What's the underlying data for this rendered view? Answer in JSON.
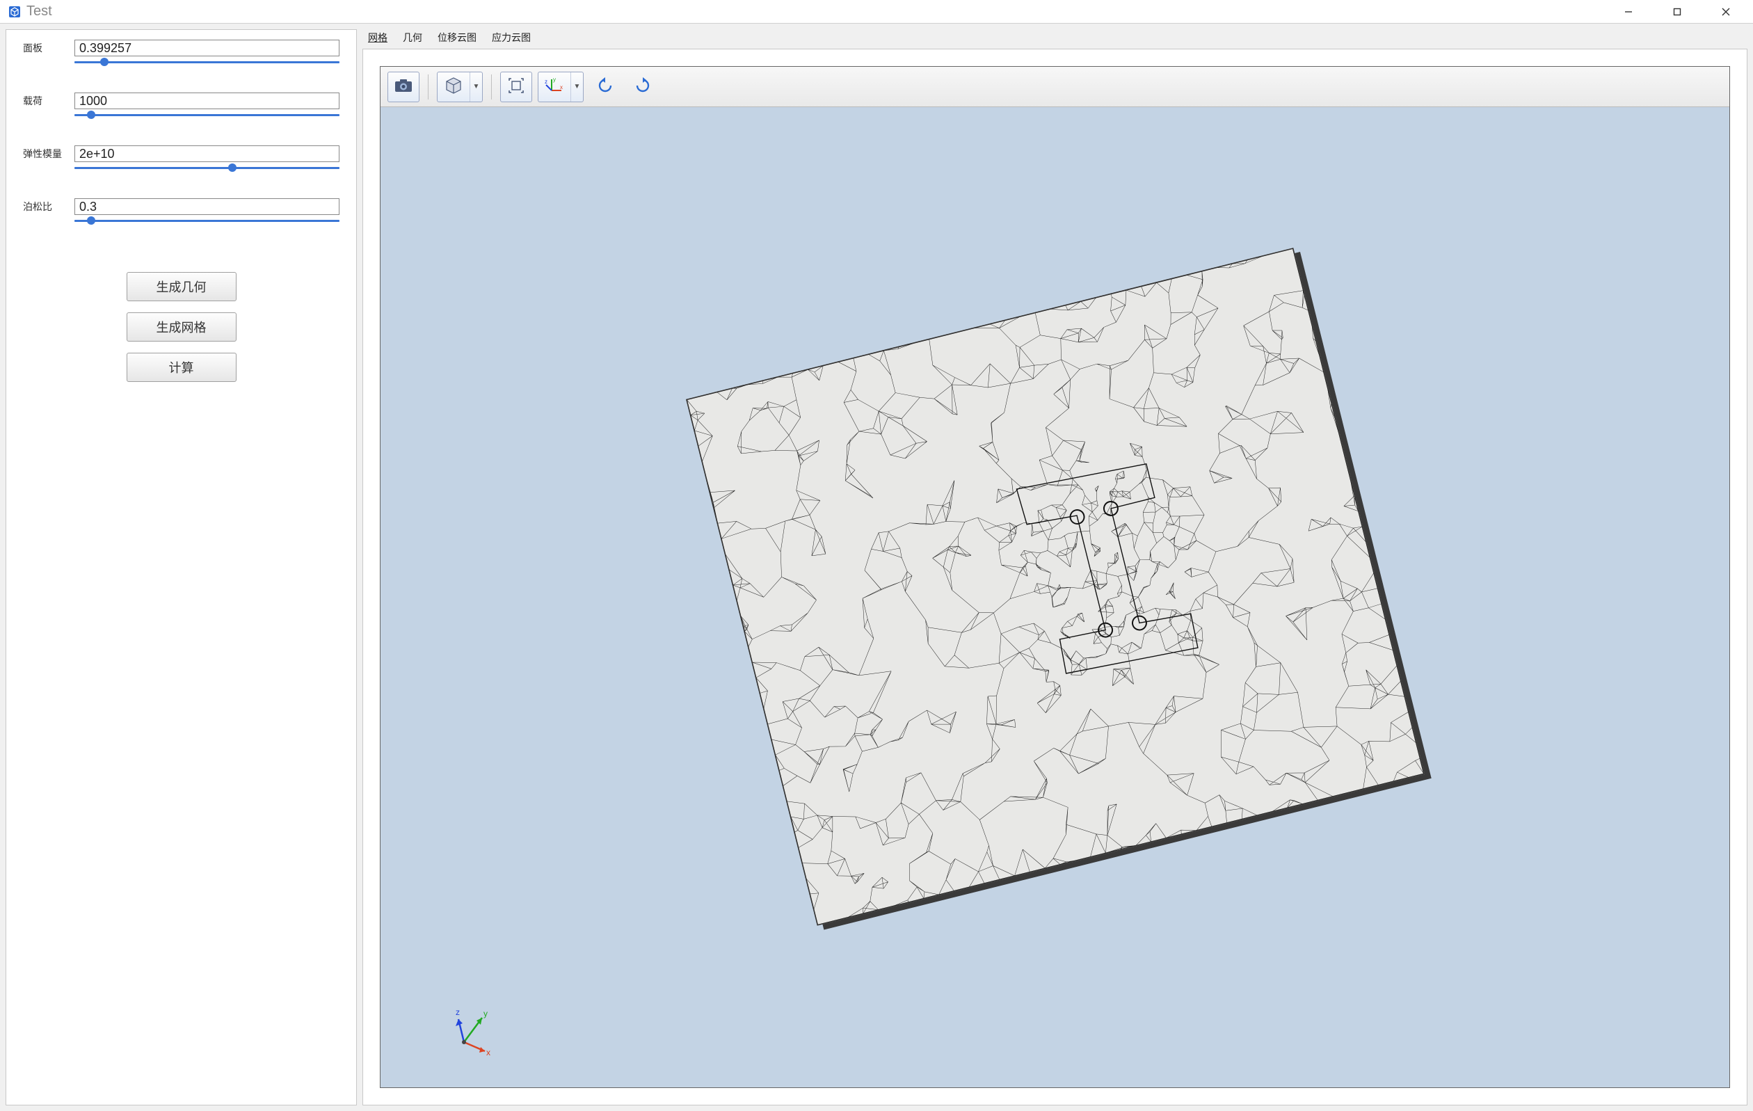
{
  "window": {
    "title": "Test"
  },
  "params": {
    "plate": {
      "label": "面板",
      "value": "0.399257",
      "slider": 10
    },
    "load": {
      "label": "载荷",
      "value": "1000",
      "slider": 5
    },
    "modulus": {
      "label": "弹性模量",
      "value": "2e+10",
      "slider": 60
    },
    "poisson": {
      "label": "泊松比",
      "value": "0.3",
      "slider": 5
    }
  },
  "buttons": {
    "gen_geometry": "生成几何",
    "gen_mesh": "生成网格",
    "compute": "计算"
  },
  "tabs": {
    "mesh": "网格",
    "geometry": "几何",
    "displacement": "位移云图",
    "stress": "应力云图"
  },
  "triad": {
    "x": "x",
    "y": "y",
    "z": "z"
  }
}
